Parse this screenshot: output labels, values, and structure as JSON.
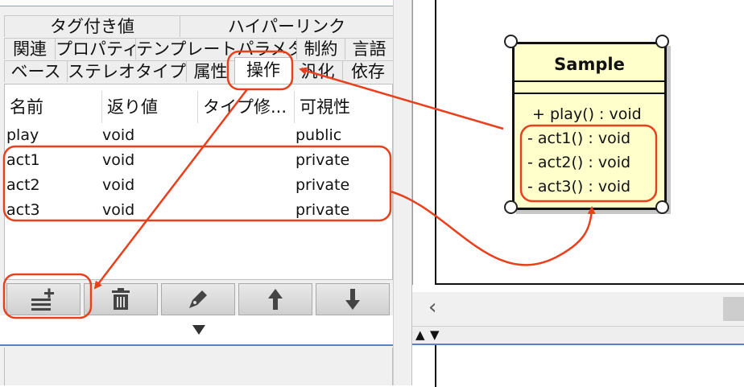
{
  "tabs": {
    "row1": [
      "タグ付き値",
      "ハイパーリンク"
    ],
    "row2": [
      "関連",
      "プロパティ",
      "テンプレートパラメタ",
      "制約",
      "言語"
    ],
    "row3": [
      "ベース",
      "ステレオタイプ",
      "属性",
      "操作",
      "汎化",
      "依存"
    ],
    "selected": "操作"
  },
  "operations_table": {
    "headers": [
      "名前",
      "返り値",
      "タイプ修...",
      "可視性"
    ],
    "rows": [
      {
        "name": "play",
        "return": "void",
        "type_mod": "",
        "visibility": "public"
      },
      {
        "name": "act1",
        "return": "void",
        "type_mod": "",
        "visibility": "private"
      },
      {
        "name": "act2",
        "return": "void",
        "type_mod": "",
        "visibility": "private"
      },
      {
        "name": "act3",
        "return": "void",
        "type_mod": "",
        "visibility": "private"
      }
    ]
  },
  "toolbar": {
    "add_icon": "add-operation-icon",
    "delete_icon": "trash-icon",
    "edit_icon": "pencil-icon",
    "up_icon": "arrow-up-icon",
    "down_icon": "arrow-down-icon",
    "expand_icon": "chevron-down-icon"
  },
  "diagram": {
    "class_name": "Sample",
    "operations": [
      "+ play() : void",
      "- act1() : void",
      "- act2() : void",
      "- act3() : void"
    ]
  },
  "scroll": {
    "left_arrow": "‹",
    "split_up": "▲",
    "split_down": "▼"
  },
  "colors": {
    "annotation": "#e8401c",
    "class_fill": "#ffffcc",
    "panel_bg": "#f0f0f0"
  }
}
